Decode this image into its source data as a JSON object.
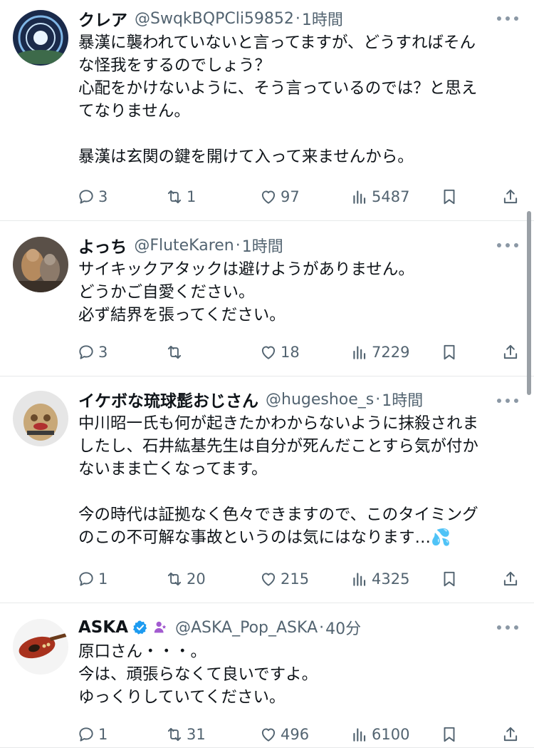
{
  "tweets": [
    {
      "name": "クレア",
      "handle": "@SwqkBQPCli59852",
      "separator": "·",
      "time": "1時間",
      "lines": [
        "暴漢に襲われていないと言ってますが、どうすればそん",
        "な怪我をするのでしょう？",
        "心配をかけないように、そう言っているのでは？と思え",
        "てなりません。",
        "",
        "暴漢は玄関の鍵を開けて入って来ませんから。"
      ],
      "replies": "3",
      "retweets": "1",
      "likes": "97",
      "views": "5487"
    },
    {
      "name": "よっち",
      "handle": "@FluteKaren",
      "separator": "·",
      "time": "1時間",
      "lines": [
        "サイキックアタックは避けようがありません。",
        "どうかご自愛ください。",
        "必ず結界を張ってください。"
      ],
      "replies": "3",
      "retweets": "",
      "likes": "18",
      "views": "7229"
    },
    {
      "name": "イケボな琉球髭おじさん",
      "handle": "@hugeshoe_s",
      "separator": "·",
      "time": "1時間",
      "lines": [
        "中川昭一氏も何が起きたかわからないように抹殺されま",
        "したし、石井紘基先生は自分が死んだことすら気が付か",
        "ないまま亡くなってます。",
        "",
        "今の時代は証拠なく色々できますので、このタイミング",
        "のこの不可解な事故というのは気にはなります…💦"
      ],
      "replies": "1",
      "retweets": "20",
      "likes": "215",
      "views": "4325"
    },
    {
      "name": "ASKA",
      "handle": "@ASKA_Pop_ASKA",
      "separator": "·",
      "time": "40分",
      "lines": [
        "原口さん・・・。",
        "今は、頑張らなくて良いですよ。",
        "ゆっくりしていてください。"
      ],
      "replies": "1",
      "retweets": "31",
      "likes": "496",
      "views": "6100"
    }
  ],
  "icons": {
    "reply": "reply-icon",
    "retweet": "retweet-icon",
    "like": "like-icon",
    "views": "views-icon",
    "bookmark": "bookmark-icon",
    "share": "share-icon",
    "more": "more-icon",
    "verified": "verified-badge-icon",
    "affiliate": "affiliate-badge-icon"
  },
  "colors": {
    "text": "#0f1419",
    "secondary": "#536471",
    "divider": "#e7e9ea",
    "verified": "#1d9bf0",
    "affiliate": "#a35bd0"
  }
}
